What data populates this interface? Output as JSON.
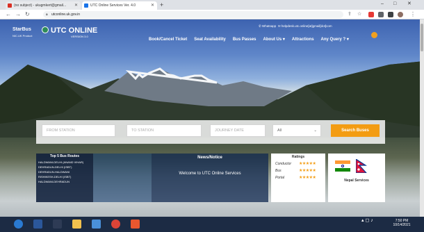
{
  "browser": {
    "tabs": [
      {
        "label": "(no subject) - ukugmkert@gmail...",
        "active": false,
        "favicon_color": "#d93025"
      },
      {
        "label": "UTC Online Services Ver. 4.0",
        "active": true,
        "favicon_color": "#1a73e8"
      }
    ],
    "new_tab_label": "+",
    "url": "utconline.uk.gov.in",
    "window_controls": [
      "–",
      "□",
      "✕"
    ]
  },
  "site": {
    "logo_title": "StarBus",
    "logo_subtitle": "NIC.UK Product",
    "brand_title": "UTC ONLINE",
    "brand_version": "VERSION 3.0",
    "contact_whatsapp": "Whatsapp",
    "contact_email": "helpdesk.utc.online[at]gmail[dot]com",
    "nav": [
      "Book/Cancel Ticket",
      "Seat Availability",
      "Bus Passes",
      "About Us ▾",
      "Attractions",
      "Any Query ? ▾"
    ]
  },
  "search": {
    "from_placeholder": "FROM STATION",
    "to_placeholder": "TO STATION",
    "date_placeholder": "JOURNEY DATE",
    "class_value": "All",
    "button_label": "Search Buses"
  },
  "routes": {
    "title": "Top 5 Bus Routes",
    "items": [
      "HALDWANI-DELHI (ANAND VIHAR)",
      "DEHRADUN-DELHI (ISBT)",
      "DEHRADUN-HALDWANI",
      "RISHIKESH-DELHI (ISBT)",
      "HALDWANI-DEHRADUN"
    ]
  },
  "news": {
    "title": "News/Notice",
    "message": "Welcome to UTC Online Services"
  },
  "ratings": {
    "title": "Ratings",
    "rows": [
      {
        "label": "Conductor",
        "stars": "★★★★★"
      },
      {
        "label": "Bus",
        "stars": "★★★★★"
      },
      {
        "label": "Portal",
        "stars": "★★★★★"
      }
    ]
  },
  "nepal": {
    "label": "Nepal Services"
  },
  "taskbar": {
    "time": "7:50 PM",
    "date": "10/14/2021",
    "apps": [
      {
        "name": "ie",
        "color": "#2a7ad2"
      },
      {
        "name": "word",
        "color": "#2b579a"
      },
      {
        "name": "media",
        "color": "#2e3b55"
      },
      {
        "name": "explorer",
        "color": "#f2c14e"
      },
      {
        "name": "mail",
        "color": "#4a90d9"
      },
      {
        "name": "chrome",
        "color": "#db4437"
      },
      {
        "name": "screen",
        "color": "#e8572f"
      }
    ]
  }
}
